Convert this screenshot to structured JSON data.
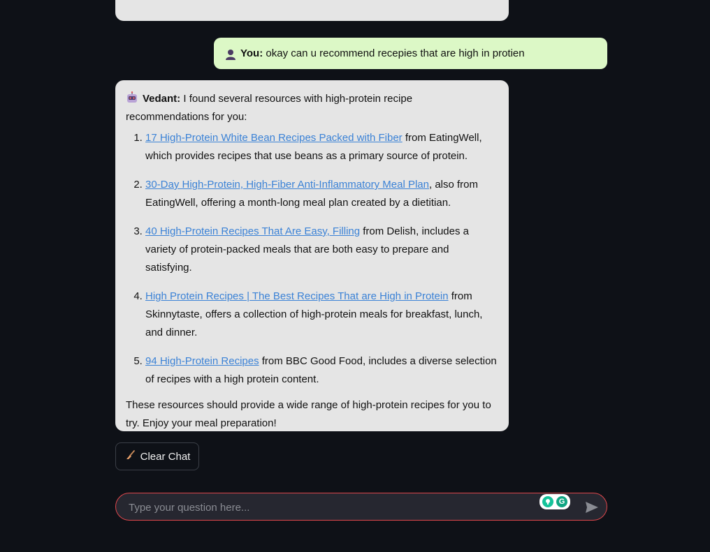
{
  "user_message": {
    "sender": "You:",
    "text": "okay can u recommend recepies that are high in protien"
  },
  "bot_message": {
    "sender": "Vedant:",
    "intro": "I found several resources with high-protein recipe recommendations for you:",
    "items": [
      {
        "link": "17 High-Protein White Bean Recipes Packed with Fiber",
        "text": " from EatingWell, which provides recipes that use beans as a primary source of protein."
      },
      {
        "link": "30-Day High-Protein, High-Fiber Anti-Inflammatory Meal Plan",
        "text": ", also from EatingWell, offering a month-long meal plan created by a dietitian."
      },
      {
        "link": "40 High-Protein Recipes That Are Easy, Filling",
        "text": " from Delish, includes a variety of protein-packed meals that are both easy to prepare and satisfying."
      },
      {
        "link": "High Protein Recipes | The Best Recipes That are High in Protein",
        "text": " from Skinnytaste, offers a collection of high-protein meals for breakfast, lunch, and dinner."
      },
      {
        "link": "94 High-Protein Recipes",
        "text": " from BBC Good Food, includes a diverse selection of recipes with a high protein content."
      }
    ],
    "closing": "These resources should provide a wide range of high-protein recipes for you to try. Enjoy your meal preparation!"
  },
  "clear_chat": {
    "label": "Clear Chat",
    "icon": "broom-icon"
  },
  "chat_input": {
    "placeholder": "Type your question here...",
    "value": ""
  },
  "colors": {
    "background": "#0e1117",
    "bot_bubble": "#e5e5e5",
    "user_bubble": "#dcf8c6",
    "link": "#3b82d6",
    "input_border": "#e0474c"
  }
}
